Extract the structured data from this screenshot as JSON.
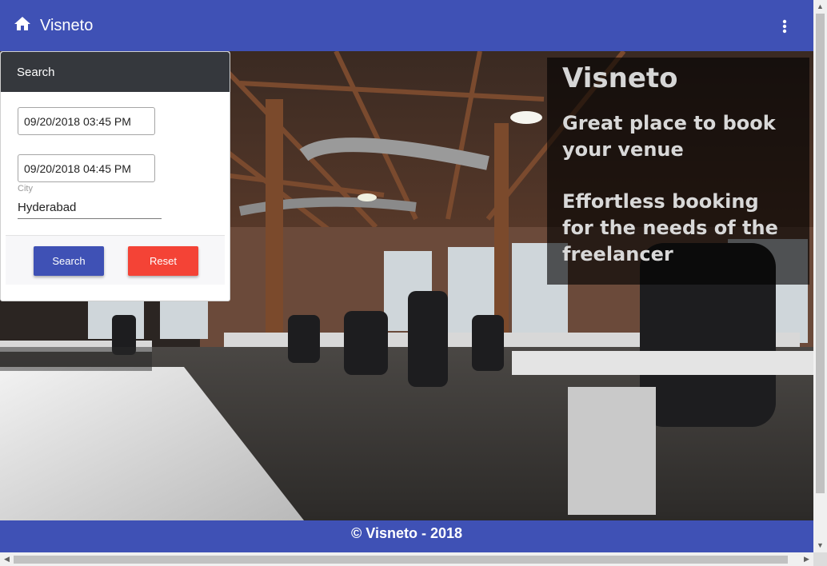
{
  "appbar": {
    "title": "Visneto",
    "background": "#3f51b5",
    "home_icon": "home-icon",
    "menu_icon": "more-vert-icon"
  },
  "hero": {
    "title": "Visneto",
    "line1": "Great place to book your venue",
    "line2": "Effortless booking for the needs of the freelancer"
  },
  "search": {
    "header": "Search",
    "start_datetime": "09/20/2018 03:45 PM",
    "end_datetime": "09/20/2018 04:45 PM",
    "city_label": "City",
    "city_value": "Hyderabad",
    "search_button": "Search",
    "reset_button": "Reset",
    "search_color": "#3f51b5",
    "reset_color": "#f44336"
  },
  "footer": {
    "text": "© Visneto - 2018"
  }
}
